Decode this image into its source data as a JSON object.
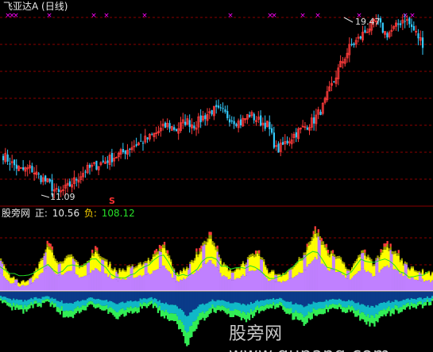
{
  "main_chart": {
    "title": "飞亚达A",
    "period": "(日线)",
    "high_label": "19.47",
    "low_label": "11.09",
    "signal_letter": "S"
  },
  "sub_chart": {
    "name": "股旁网",
    "pos_label": "正:",
    "pos_value": "10.56",
    "neg_label": "负:",
    "neg_value": "108.12"
  },
  "watermark": {
    "cn": "股旁网",
    "url": "www.gupang.com"
  },
  "colors": {
    "up": "#ff3b3b",
    "down": "#33ccff",
    "grid": "#8b0000",
    "magenta": "#ff00ff",
    "yellow": "#ffff00",
    "violet": "#c080ff",
    "olive": "#9a9a00",
    "green_line": "#22dd22"
  },
  "chart_data": [
    {
      "type": "candlestick",
      "title": "飞亚达A (日线)",
      "annotations": [
        {
          "text": "19.47",
          "kind": "high"
        },
        {
          "text": "11.09",
          "kind": "low"
        }
      ],
      "y_range": [
        11.09,
        19.47
      ],
      "close_path": [
        13.0,
        12.6,
        12.3,
        12.4,
        12.0,
        11.7,
        11.2,
        11.5,
        11.9,
        12.3,
        12.5,
        12.7,
        12.9,
        13.1,
        13.4,
        13.6,
        13.8,
        14.1,
        14.4,
        14.2,
        14.6,
        14.4,
        14.8,
        15.1,
        15.0,
        14.7,
        14.5,
        14.9,
        14.6,
        14.4,
        13.2,
        13.6,
        14.0,
        14.3,
        14.6,
        15.2,
        16.2,
        17.2,
        18.0,
        18.4,
        18.9,
        19.2,
        18.6,
        18.9,
        19.4,
        18.8,
        18.2
      ]
    },
    {
      "type": "area",
      "title": "股旁网",
      "series": [
        {
          "name": "正",
          "last_value": 10.56
        },
        {
          "name": "负",
          "last_value": 108.12
        }
      ],
      "upper_profile": [
        0.45,
        0.2,
        0.12,
        0.3,
        0.7,
        0.4,
        0.55,
        0.35,
        0.6,
        0.45,
        0.3,
        0.35,
        0.4,
        0.5,
        0.7,
        0.25,
        0.35,
        0.6,
        0.85,
        0.4,
        0.3,
        0.45,
        0.6,
        0.3,
        0.25,
        0.35,
        0.55,
        0.9,
        0.6,
        0.5,
        0.3,
        0.6,
        0.4,
        0.7,
        0.55,
        0.35,
        0.3,
        0.25
      ],
      "lower_profile": [
        0.2,
        0.3,
        0.35,
        0.25,
        0.2,
        0.35,
        0.5,
        0.3,
        0.25,
        0.35,
        0.45,
        0.4,
        0.3,
        0.25,
        0.45,
        0.5,
        0.95,
        0.55,
        0.35,
        0.3,
        0.45,
        0.5,
        0.35,
        0.3,
        0.25,
        0.45,
        0.55,
        0.4,
        0.35,
        0.3,
        0.35,
        0.5,
        0.6,
        0.4,
        0.35,
        0.3,
        0.25,
        0.2
      ]
    }
  ]
}
